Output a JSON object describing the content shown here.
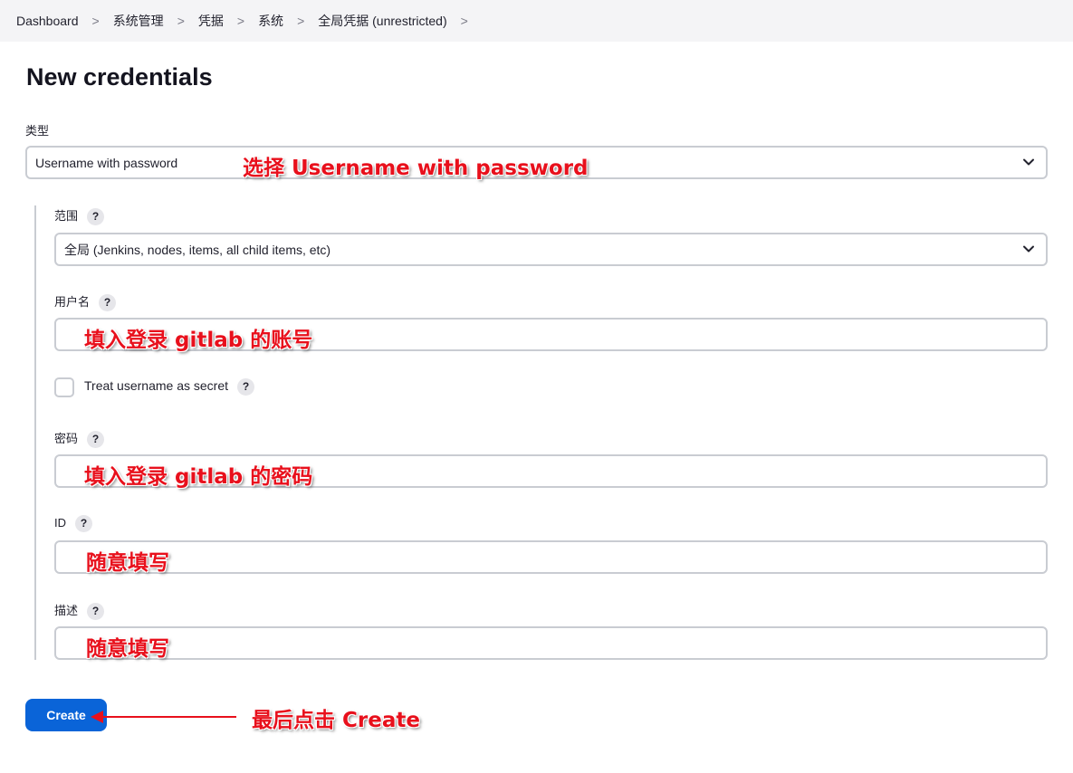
{
  "breadcrumb": {
    "items": [
      "Dashboard",
      "系统管理",
      "凭据",
      "系统",
      "全局凭据 (unrestricted)"
    ]
  },
  "page": {
    "title": "New credentials"
  },
  "form": {
    "kind_label": "类型",
    "kind_value": "Username with password",
    "scope_label": "范围",
    "scope_value": "全局 (Jenkins, nodes, items, all child items, etc)",
    "username_label": "用户名",
    "username_value": "",
    "secret_checkbox_label": "Treat username as secret",
    "secret_checked": false,
    "password_label": "密码",
    "password_value": "",
    "id_label": "ID",
    "id_value": "",
    "description_label": "描述",
    "description_value": "",
    "help_glyph": "?",
    "create_label": "Create"
  },
  "annotations": {
    "kind": "选择 Username with password",
    "username": "填入登录 gitlab 的账号",
    "password": "填入登录 gitlab 的密码",
    "id": "随意填写",
    "description": "随意填写",
    "create": "最后点击 Create"
  },
  "colors": {
    "accent": "#0a64d8",
    "annotation_red": "#e8101c",
    "breadcrumb_bg": "#f4f4f6"
  }
}
